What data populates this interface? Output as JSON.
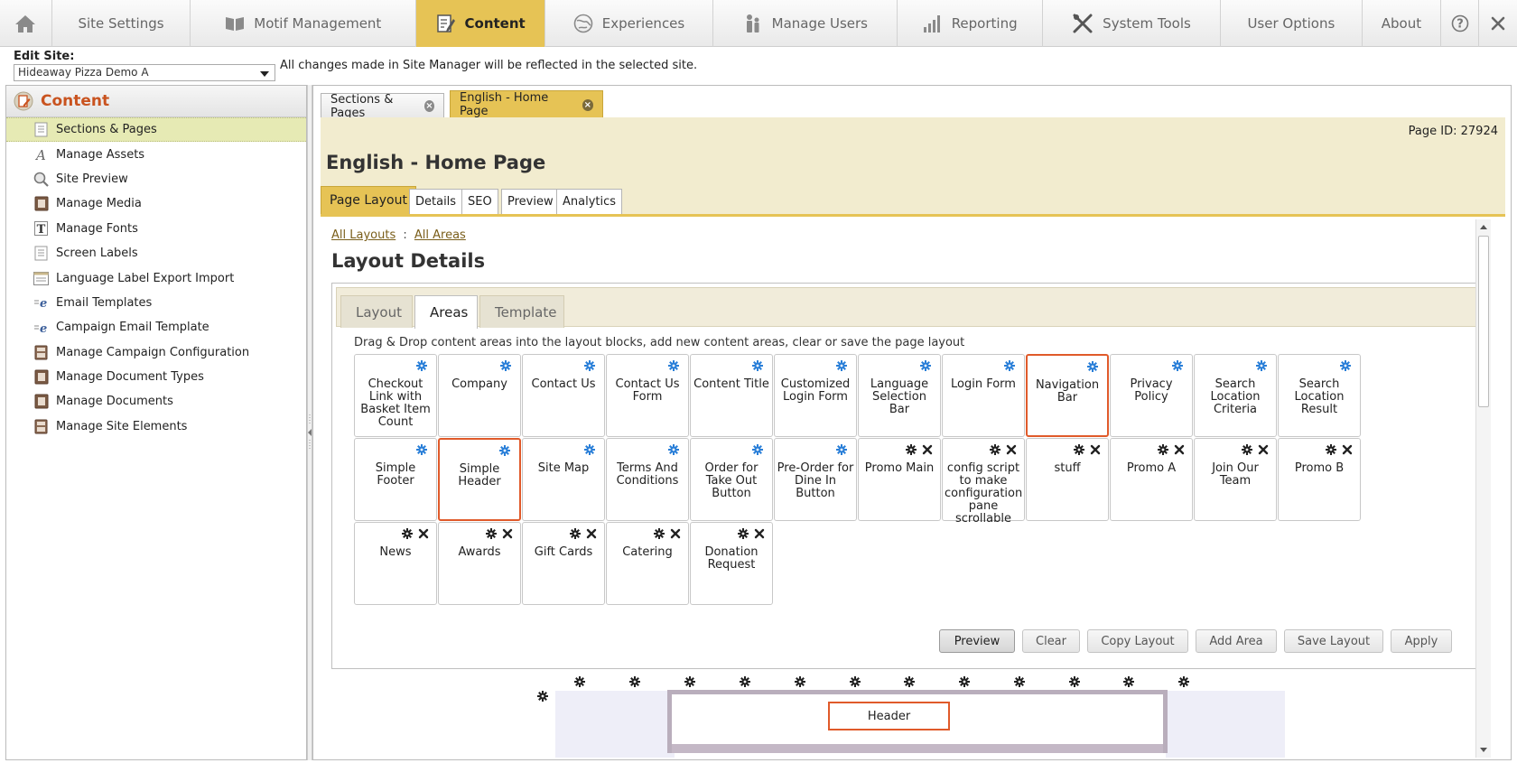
{
  "nav": {
    "items": [
      {
        "label": "Site Settings"
      },
      {
        "label": "Motif Management"
      },
      {
        "label": "Content"
      },
      {
        "label": "Experiences"
      },
      {
        "label": "Manage Users"
      },
      {
        "label": "Reporting"
      },
      {
        "label": "System Tools"
      },
      {
        "label": "User Options"
      },
      {
        "label": "About"
      }
    ],
    "active": "Content"
  },
  "site": {
    "edit_label": "Edit Site:",
    "selected": "Hideaway Pizza Demo A",
    "note": "All changes made in Site Manager will be reflected in the selected site."
  },
  "sidebar": {
    "title": "Content",
    "items": [
      {
        "label": "Sections & Pages",
        "icon": "page-list-icon"
      },
      {
        "label": "Manage Assets",
        "icon": "font-a-icon"
      },
      {
        "label": "Site Preview",
        "icon": "magnifier-icon"
      },
      {
        "label": "Manage Media",
        "icon": "media-icon"
      },
      {
        "label": "Manage Fonts",
        "icon": "font-t-icon"
      },
      {
        "label": "Screen Labels",
        "icon": "page-list-icon"
      },
      {
        "label": "Language Label Export Import",
        "icon": "table-icon"
      },
      {
        "label": "Email Templates",
        "icon": "email-e-icon"
      },
      {
        "label": "Campaign Email Template",
        "icon": "email-e-icon"
      },
      {
        "label": "Manage Campaign Configuration",
        "icon": "document-box-icon"
      },
      {
        "label": "Manage Document Types",
        "icon": "media-icon"
      },
      {
        "label": "Manage Documents",
        "icon": "media-icon"
      },
      {
        "label": "Manage Site Elements",
        "icon": "document-box-icon"
      }
    ]
  },
  "doc_tabs": [
    {
      "label": "Sections & Pages"
    },
    {
      "label": "English - Home Page"
    }
  ],
  "page": {
    "id_text": "Page ID: 27924",
    "title": "English - Home Page",
    "tabs": [
      {
        "label": "Page Layout"
      },
      {
        "label": "Details"
      },
      {
        "label": "SEO"
      },
      {
        "label": "Preview"
      },
      {
        "label": "Analytics"
      }
    ]
  },
  "breadcrumb": {
    "all_layouts": "All Layouts",
    "separator": ":",
    "all_areas": "All Areas"
  },
  "layout": {
    "title": "Layout Details",
    "tabs": [
      {
        "label": "Layout"
      },
      {
        "label": "Areas"
      },
      {
        "label": "Template"
      }
    ],
    "instructions": "Drag & Drop content areas into the layout blocks, add new content areas, clear or save the page layout"
  },
  "areas": [
    {
      "label": "Checkout Link with Basket Item Count",
      "kind": "system"
    },
    {
      "label": "Company",
      "kind": "system"
    },
    {
      "label": "Contact Us",
      "kind": "system"
    },
    {
      "label": "Contact Us Form",
      "kind": "system"
    },
    {
      "label": "Content Title",
      "kind": "system"
    },
    {
      "label": "Customized Login Form",
      "kind": "system"
    },
    {
      "label": "Language Selection Bar",
      "kind": "system"
    },
    {
      "label": "Login Form",
      "kind": "system"
    },
    {
      "label": "Navigation Bar",
      "kind": "system",
      "highlight": true
    },
    {
      "label": "Privacy Policy",
      "kind": "system"
    },
    {
      "label": "Search Location Criteria",
      "kind": "system"
    },
    {
      "label": "Search Location Result",
      "kind": "system"
    },
    {
      "label": "Simple Footer",
      "kind": "system"
    },
    {
      "label": "Simple Header",
      "kind": "system",
      "highlight": true
    },
    {
      "label": "Site Map",
      "kind": "system"
    },
    {
      "label": "Terms And Conditions",
      "kind": "system"
    },
    {
      "label": "Order for Take Out Button",
      "kind": "system"
    },
    {
      "label": "Pre-Order for Dine In Button",
      "kind": "system"
    },
    {
      "label": "Promo Main",
      "kind": "custom"
    },
    {
      "label": "config script to make configuration pane scrollable",
      "kind": "custom"
    },
    {
      "label": "stuff",
      "kind": "custom"
    },
    {
      "label": "Promo A",
      "kind": "custom"
    },
    {
      "label": "Join Our Team",
      "kind": "custom"
    },
    {
      "label": "Promo B",
      "kind": "custom"
    },
    {
      "label": "News",
      "kind": "custom"
    },
    {
      "label": "Awards",
      "kind": "custom"
    },
    {
      "label": "Gift Cards",
      "kind": "custom"
    },
    {
      "label": "Catering",
      "kind": "custom"
    },
    {
      "label": "Donation Request",
      "kind": "custom"
    }
  ],
  "actions": [
    {
      "label": "Preview"
    },
    {
      "label": "Clear"
    },
    {
      "label": "Copy Layout"
    },
    {
      "label": "Add Area"
    },
    {
      "label": "Save Layout"
    },
    {
      "label": "Apply"
    }
  ],
  "canvas": {
    "header_block": "Header"
  },
  "colors": {
    "accent": "#e6c355",
    "brand": "#c9531f",
    "highlight": "#e05a2a",
    "gear_system": "#2a7fd8"
  }
}
